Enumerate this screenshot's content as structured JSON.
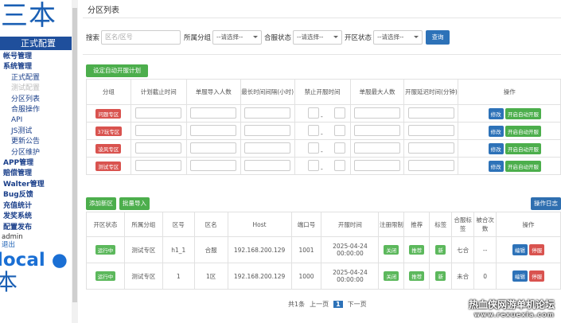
{
  "sidebar": {
    "logo": "三本",
    "env": "正式配置",
    "menu": [
      {
        "label": "帐号管理",
        "type": "grp"
      },
      {
        "label": "系统管理",
        "type": "grp"
      },
      {
        "label": "正式配置",
        "type": "sub"
      },
      {
        "label": "测试配置",
        "type": "sub dim"
      },
      {
        "label": "分区列表",
        "type": "sub"
      },
      {
        "label": "合服操作",
        "type": "sub"
      },
      {
        "label": "API",
        "type": "sub"
      },
      {
        "label": "JS测试",
        "type": "sub"
      },
      {
        "label": "更新公告",
        "type": "sub"
      },
      {
        "label": "分区维护",
        "type": "sub"
      },
      {
        "label": "APP管理",
        "type": "grp"
      },
      {
        "label": "赔偿管理",
        "type": "grp"
      },
      {
        "label": "Walter管理",
        "type": "grp"
      },
      {
        "label": "Bug反馈",
        "type": "grp"
      },
      {
        "label": "充值统计",
        "type": "grp"
      },
      {
        "label": "发奖系统",
        "type": "grp"
      },
      {
        "label": "配置发布",
        "type": "grp"
      }
    ],
    "user": "admin",
    "logout": "退出",
    "big1": "local ●",
    "big2": "本"
  },
  "page": {
    "title": "分区列表"
  },
  "filter": {
    "search_label": "搜索",
    "search_placeholder": "区名/区号",
    "group_label": "所属分组",
    "group_value": "--请选择--",
    "merge_label": "合服状态",
    "merge_value": "--请选择--",
    "open_label": "开区状态",
    "open_value": "--请选择--",
    "query": "查询"
  },
  "plan": {
    "button": "设定自动开服计划",
    "headers": [
      "分组",
      "计划截止时间",
      "单服导入人数",
      "最长时间间隔(小时)",
      "禁止开服时间",
      "单服最大人数",
      "开服延迟时间(分钟)",
      "操作"
    ],
    "rows": [
      {
        "group": "问题专区",
        "color": "#d9534f"
      },
      {
        "group": "37玩专区",
        "color": "#d9534f"
      },
      {
        "group": "凌风专区",
        "color": "#d9534f"
      },
      {
        "group": "测试专区",
        "color": "#d9534f"
      }
    ],
    "dash": "-",
    "edit": "修改",
    "auto": "开启自动开服"
  },
  "servers": {
    "add": "添加新区",
    "batch": "批量导入",
    "log": "操作日志",
    "headers": [
      "开区状态",
      "所属分组",
      "区号",
      "区名",
      "Host",
      "端口号",
      "开服时间",
      "注册限制",
      "推荐",
      "标签",
      "合服标签",
      "被合次数",
      "操作"
    ],
    "rows": [
      {
        "status": "运行中",
        "group": "测试专区",
        "id": "h1_1",
        "name": "合服",
        "host": "192.168.200.129",
        "port": "1001",
        "time": "2025-04-24 00:00:00",
        "reg": "关闭",
        "rec": "推荐",
        "tag": "新",
        "merge": "七合",
        "count": "--"
      },
      {
        "status": "运行中",
        "group": "测试专区",
        "id": "1",
        "name": "1区",
        "host": "192.168.200.129",
        "port": "1000",
        "time": "2025-04-24 00:00:00",
        "reg": "关闭",
        "rec": "推荐",
        "tag": "新",
        "merge": "未合",
        "count": "0"
      }
    ],
    "edit": "编辑",
    "stop": "停服"
  },
  "pager": {
    "total": "共1条",
    "prev": "上一页",
    "current": "1",
    "next": "下一页"
  },
  "watermark": {
    "line1": "热血侠网游单机论坛",
    "line2": "www.rexuexia.com"
  }
}
